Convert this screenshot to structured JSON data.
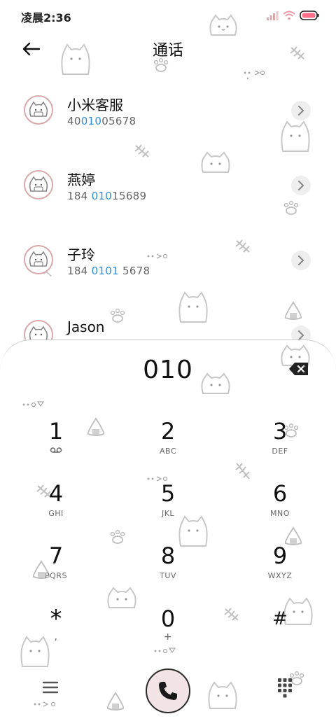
{
  "status_bar": {
    "time": "凌晨2:36",
    "icons": [
      "signal-icon",
      "wifi-icon",
      "battery-icon"
    ]
  },
  "header": {
    "title": "通话",
    "back_icon": "arrow-left-icon"
  },
  "contacts": [
    {
      "name": "小米客服",
      "number_pre": "40",
      "number_match": "010",
      "number_post": "05678"
    },
    {
      "name": "燕婷",
      "number_pre": "184 ",
      "number_match": "010",
      "number_post": "15689"
    },
    {
      "name": "子玲",
      "number_pre": "184 ",
      "number_match": "0101",
      "number_post": " 5678"
    },
    {
      "name": "Jason",
      "number_pre": "",
      "number_match": "",
      "number_post": ""
    }
  ],
  "dialer": {
    "input": "010",
    "keys": [
      {
        "digit": "1",
        "letters": ""
      },
      {
        "digit": "2",
        "letters": "ABC"
      },
      {
        "digit": "3",
        "letters": "DEF"
      },
      {
        "digit": "4",
        "letters": "GHI"
      },
      {
        "digit": "5",
        "letters": "JKL"
      },
      {
        "digit": "6",
        "letters": "MNO"
      },
      {
        "digit": "7",
        "letters": "PQRS"
      },
      {
        "digit": "8",
        "letters": "TUV"
      },
      {
        "digit": "9",
        "letters": "WXYZ"
      },
      {
        "digit": "*",
        "letters": ","
      },
      {
        "digit": "0",
        "letters": "+"
      },
      {
        "digit": "#",
        "letters": ""
      }
    ]
  },
  "colors": {
    "highlight": "#2f8fdc",
    "avatar_ring": "#d9a9ad",
    "call_button_bg": "#f2e4e4",
    "battery_fill": "#ff6f8a"
  }
}
